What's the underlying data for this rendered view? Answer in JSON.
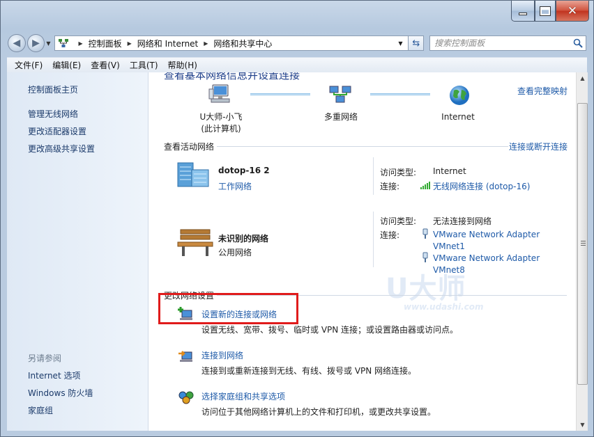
{
  "window": {
    "caption_buttons": {
      "minimize": "minimize",
      "maximize": "maximize",
      "close": "✕"
    }
  },
  "address_bar": {
    "breadcrumbs": [
      "控制面板",
      "网络和 Internet",
      "网络和共享中心"
    ]
  },
  "search": {
    "placeholder": "搜索控制面板"
  },
  "menu": {
    "file": "文件(F)",
    "edit": "编辑(E)",
    "view": "查看(V)",
    "tools": "工具(T)",
    "help": "帮助(H)"
  },
  "sidebar": {
    "home": "控制面板主页",
    "items": [
      "管理无线网络",
      "更改适配器设置",
      "更改高级共享设置"
    ],
    "see_also_title": "另请参阅",
    "see_also": [
      "Internet 选项",
      "Windows 防火墙",
      "家庭组"
    ]
  },
  "main": {
    "page_title": "查看基本网络信息并设置连接",
    "view_full_map": "查看完整映射",
    "map_nodes": [
      {
        "label": "U大师-小飞",
        "sub": "(此计算机)",
        "icon": "computer-icon"
      },
      {
        "label": "多重网络",
        "icon": "multiple-networks-icon"
      },
      {
        "label": "Internet",
        "icon": "globe-icon"
      }
    ],
    "active_networks_title": "查看活动网络",
    "connect_disconnect": "连接或断开连接",
    "networks": [
      {
        "name": "dotop-16  2",
        "type": "工作网络",
        "access_type_label": "访问类型:",
        "access_type": "Internet",
        "connections_label": "连接:",
        "connections": [
          "无线网络连接 (dotop-16)"
        ],
        "icon": "building-icon"
      },
      {
        "name": "未识别的网络",
        "type": "公用网络",
        "access_type_label": "访问类型:",
        "access_type": "无法连接到网络",
        "connections_label": "连接:",
        "connections": [
          "VMware Network Adapter VMnet1",
          "VMware Network Adapter VMnet8"
        ],
        "icon": "park-bench-icon"
      }
    ],
    "change_settings_title": "更改网络设置",
    "tasks": [
      {
        "title": "设置新的连接或网络",
        "desc": "设置无线、宽带、拨号、临时或 VPN 连接；或设置路由器或访问点。",
        "icon": "new-connection-icon"
      },
      {
        "title": "连接到网络",
        "desc": "连接到或重新连接到无线、有线、拨号或 VPN 网络连接。",
        "icon": "connect-network-icon"
      },
      {
        "title": "选择家庭组和共享选项",
        "desc": "访问位于其他网络计算机上的文件和打印机，或更改共享设置。",
        "icon": "homegroup-icon"
      }
    ]
  },
  "watermark": {
    "main": "U大师",
    "sub": "www.udashi.com"
  },
  "colors": {
    "link": "#1e5aa8",
    "highlight": "#e01b1b",
    "sidebar_bg": "#dfe9f5"
  }
}
